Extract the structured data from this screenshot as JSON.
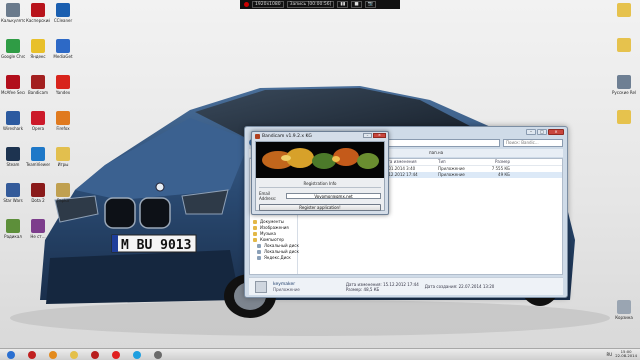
{
  "recorder_bar": {
    "resolution": "1920x1080",
    "status": "Запись [00:00:56]",
    "controls": [
      "▮▮",
      "■",
      "📷"
    ]
  },
  "desktop_icons_left": [
    {
      "label": "Калькулятор",
      "color": "#6a7a8c"
    },
    {
      "label": "Касперский",
      "color": "#b8141c"
    },
    {
      "label": "CCleaner",
      "color": "#1b5fb0"
    },
    {
      "label": "Google Chrome",
      "color": "#2f9c45"
    },
    {
      "label": "Яндекс",
      "color": "#e8c02a"
    },
    {
      "label": "MediaGet",
      "color": "#2d69c6"
    },
    {
      "label": "McAfee Security Sc…",
      "color": "#b20f1c"
    },
    {
      "label": "Bandicam",
      "color": "#a32020"
    },
    {
      "label": "Yandex",
      "color": "#d8241c"
    },
    {
      "label": "Wireshark",
      "color": "#2c5aa0"
    },
    {
      "label": "Opera",
      "color": "#cc1a2a"
    },
    {
      "label": "Firefox",
      "color": "#e07a1f"
    },
    {
      "label": "Steam",
      "color": "#1d3350"
    },
    {
      "label": "TeamViewer",
      "color": "#1e78c8"
    },
    {
      "label": "Игры",
      "color": "#e2bf4e"
    },
    {
      "label": "Star Wars",
      "color": "#345b9a"
    },
    {
      "label": "Dota 2",
      "color": "#8a1a1a"
    },
    {
      "label": "Papka",
      "color": "#c0a050"
    },
    {
      "label": "Радикал",
      "color": "#5d8f3a"
    },
    {
      "label": "Не ст…",
      "color": "#7d3d8c"
    }
  ],
  "desktop_icons_right": [
    {
      "label": "",
      "color": "#e6c24d"
    },
    {
      "label": "",
      "color": "#e6c24d"
    },
    {
      "label": "Русские Release",
      "color": "#6e7f93"
    },
    {
      "label": "",
      "color": "#e6c24d"
    },
    {
      "label": "Корзина",
      "color": "#9aa5b2"
    }
  ],
  "explorer": {
    "search_placeholder": "Поиск: Bandic...",
    "toolbar_text": "пап.на",
    "nav_items": [
      {
        "label": "Документы",
        "sub": false
      },
      {
        "label": "Изображения",
        "sub": false
      },
      {
        "label": "Музыка",
        "sub": false
      },
      {
        "label": "Компьютер",
        "sub": false
      },
      {
        "label": "Локальный диск",
        "sub": true
      },
      {
        "label": "Локальный диск",
        "sub": true
      },
      {
        "label": "Яндекс.Диск",
        "sub": true
      }
    ],
    "columns": [
      "Имя",
      "Дата изменения",
      "Тип",
      "Размер"
    ],
    "rows": [
      {
        "name": "",
        "date": "22.01.2014 3:40",
        "type": "Приложение",
        "size": "7 555 КБ",
        "selected": false
      },
      {
        "name": "",
        "date": "15.12.2012 17:44",
        "type": "Приложение",
        "size": "49 КБ",
        "selected": true
      }
    ],
    "details": {
      "name": "keymaker",
      "type": "Приложение",
      "modified_label": "Дата изменения:",
      "modified": "15.12.2012 17:44",
      "created_label": "Дата создания:",
      "created": "22.07.2014 13:20",
      "size_label": "Размер:",
      "size": "48,5 КБ"
    }
  },
  "keymaker": {
    "title": "Bandicam v1.9.2.x KG",
    "reg_info_label": "Registration Info",
    "email_label": "Email Address:",
    "email_value": "Vovomor@gmx.net",
    "register_button": "Register application!"
  },
  "taskbar": {
    "apps": [
      {
        "name": "start-button",
        "color": "#2a6fd1"
      },
      {
        "name": "bandicam-task",
        "color": "#c02020"
      },
      {
        "name": "cs-task",
        "color": "#e38a1c"
      },
      {
        "name": "explorer-task",
        "color": "#e4c04a"
      },
      {
        "name": "bandicam2-task",
        "color": "#b81e1e"
      },
      {
        "name": "yandex-task",
        "color": "#e02020"
      },
      {
        "name": "skype-task",
        "color": "#1e9fe0"
      },
      {
        "name": "keymaker-task",
        "color": "#6a6a6a"
      }
    ],
    "time": "15:00",
    "date": "22.08.2014",
    "lang": "RU"
  },
  "colors": {
    "window_frame": "#cfdbe8",
    "car_body": "#2c4f78",
    "taskbar": "#d8d8d8"
  }
}
